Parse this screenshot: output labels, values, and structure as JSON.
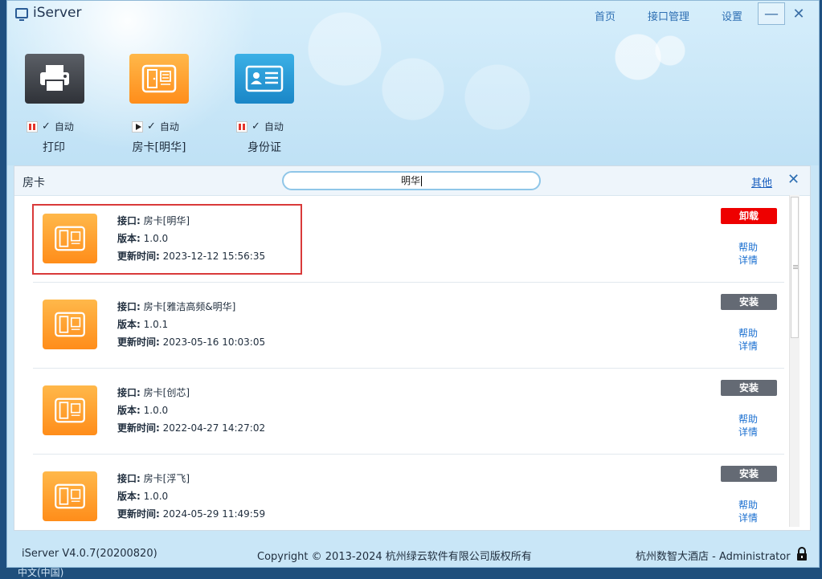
{
  "app": {
    "title": "iServer"
  },
  "nav": {
    "home": "首页",
    "interfaces": "接口管理",
    "settings": "设置"
  },
  "window_controls": {
    "minimize": "—",
    "close": "✕"
  },
  "devices": [
    {
      "label": "打印",
      "state": "paused",
      "auto_label": "自动"
    },
    {
      "label": "房卡[明华]",
      "state": "playing",
      "auto_label": "自动"
    },
    {
      "label": "身份证",
      "state": "paused",
      "auto_label": "自动"
    }
  ],
  "panel": {
    "title": "房卡",
    "search_value": "明华",
    "other_link": "其他",
    "close": "✕"
  },
  "list_labels": {
    "interface": "接口:",
    "version": "版本:",
    "updated": "更新时间:",
    "help": "帮助",
    "details": "详情"
  },
  "items": [
    {
      "name": "房卡[明华]",
      "version": "1.0.0",
      "updated": "2023-12-12 15:56:35",
      "action": "卸载",
      "action_color": "#e00000"
    },
    {
      "name": "房卡[雅洁高频&明华]",
      "version": "1.0.1",
      "updated": "2023-05-16 10:03:05",
      "action": "安装",
      "action_color": "#646a74"
    },
    {
      "name": "房卡[创芯]",
      "version": "1.0.0",
      "updated": "2022-04-27 14:27:02",
      "action": "安装",
      "action_color": "#646a74"
    },
    {
      "name": "房卡[浮飞]",
      "version": "1.0.0",
      "updated": "2024-05-29 11:49:59",
      "action": "安装",
      "action_color": "#646a74"
    }
  ],
  "status": {
    "version": "iServer V4.0.7(20200820)",
    "copyright": "Copyright © 2013-2024 杭州绿云软件有限公司版权所有",
    "user": "杭州数智大酒店 - Administrator"
  },
  "taskbar": {
    "text": "中文(中国)"
  }
}
